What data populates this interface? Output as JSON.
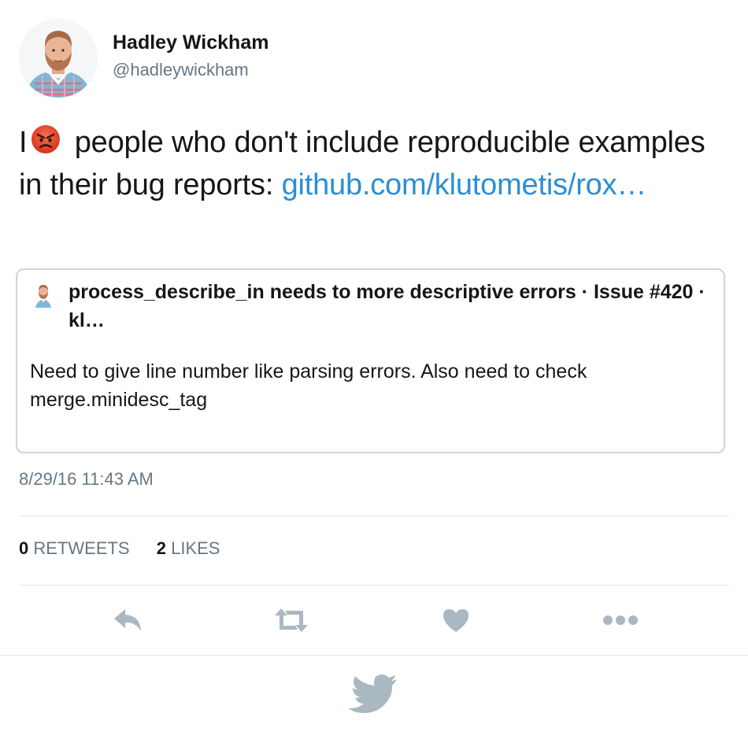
{
  "author": {
    "display_name": "Hadley Wickham",
    "handle": "@hadleywickham"
  },
  "tweet": {
    "text_before": "I",
    "emoji": "angry-face-emoji",
    "text_after": " people who don't include reproducible examples in their bug reports: ",
    "link_text": "github.com/klutometis/rox…"
  },
  "card": {
    "title": "process_describe_in needs to more descriptive errors · Issue #420 · kl…",
    "description": "Need to give line number like parsing errors. Also need to check merge.minidesc_tag"
  },
  "timestamp": "8/29/16 11:43 AM",
  "stats": {
    "retweets_count": "0",
    "retweets_label": "RETWEETS",
    "likes_count": "2",
    "likes_label": "LIKES"
  },
  "actions": {
    "reply_icon": "reply-icon",
    "retweet_icon": "retweet-icon",
    "like_icon": "heart-icon",
    "more_icon": "more-icon"
  },
  "footer": {
    "logo_icon": "twitter-bird-icon"
  },
  "colors": {
    "link": "#2b8fd6",
    "text": "#14171a",
    "secondary": "#657786",
    "icon": "#aab8c2",
    "border": "#ccd6dd"
  }
}
